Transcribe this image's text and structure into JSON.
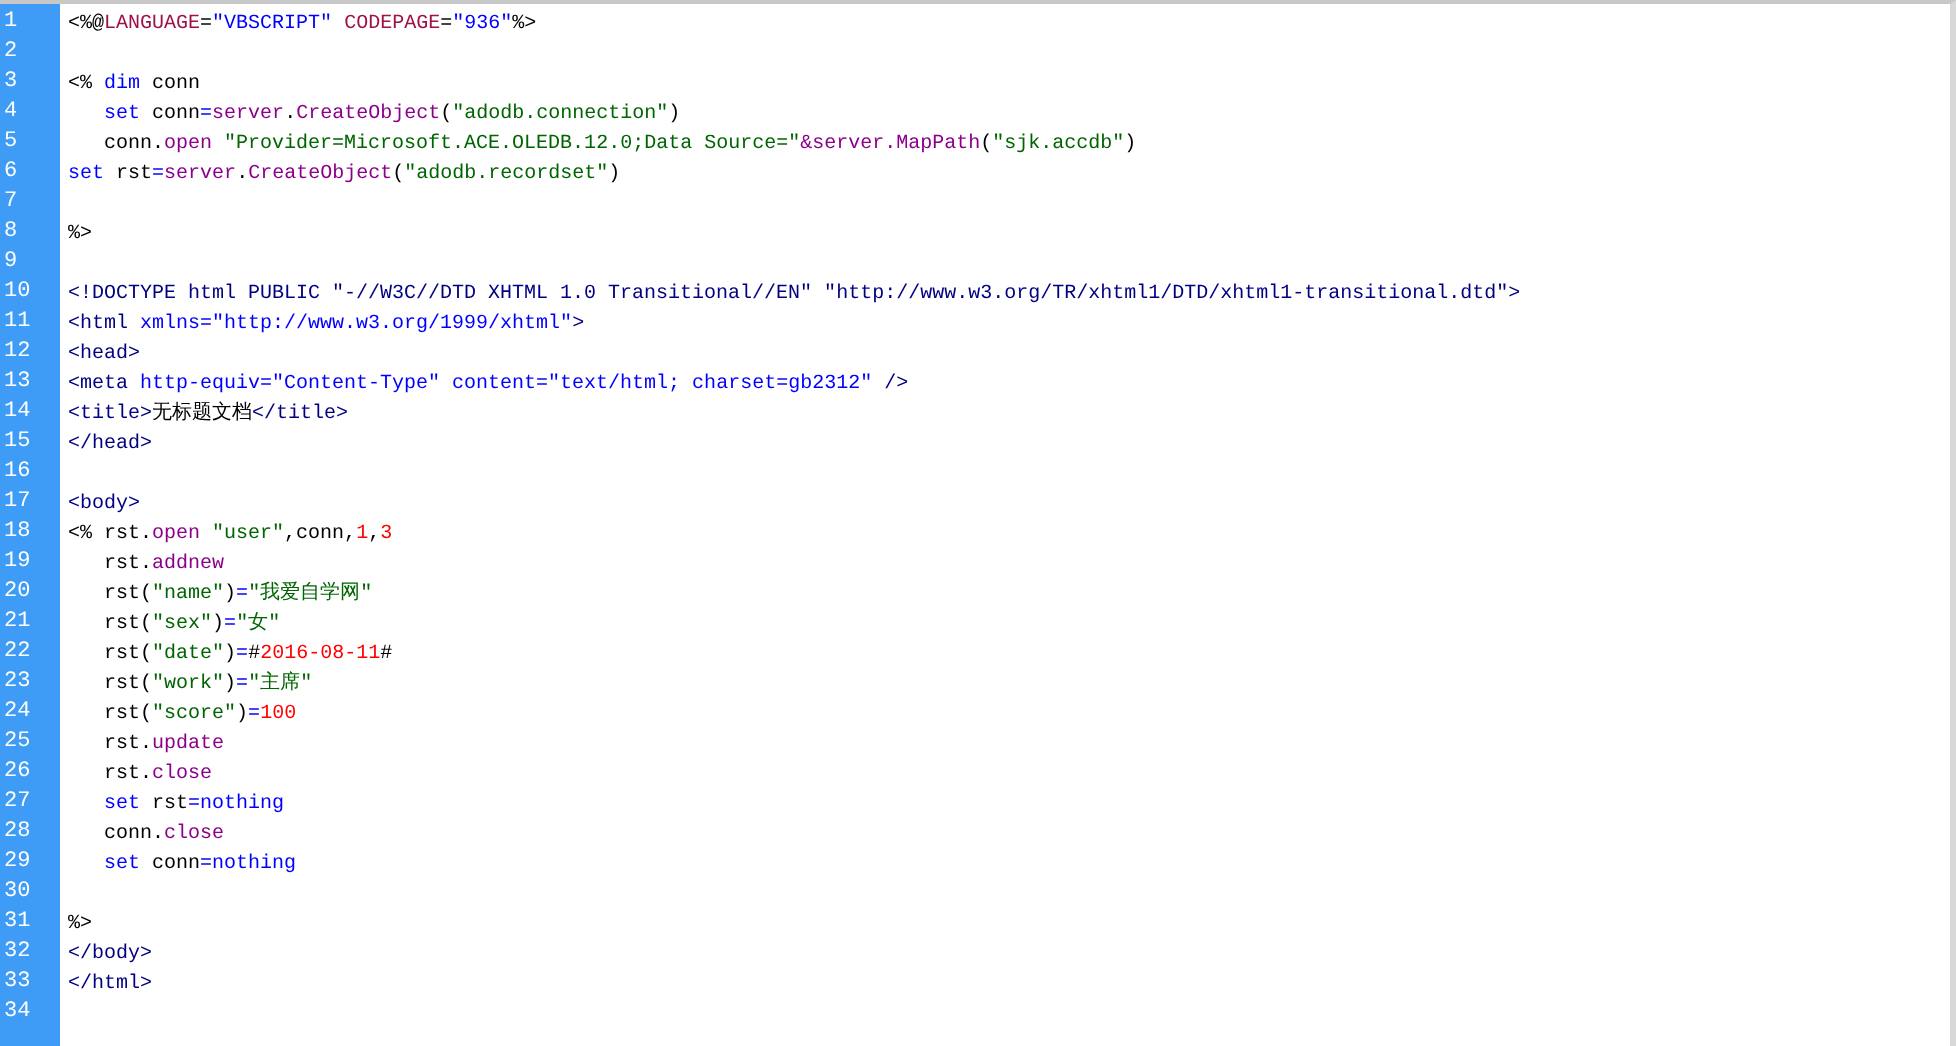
{
  "lines": [
    {
      "number": "1",
      "tokens": [
        {
          "text": "<%@",
          "kind": "plain"
        },
        {
          "text": "LANGUAGE",
          "kind": "attr"
        },
        {
          "text": "=",
          "kind": "plain"
        },
        {
          "text": "\"VBSCRIPT\"",
          "kind": "value"
        },
        {
          "text": " CODEPAGE",
          "kind": "attr"
        },
        {
          "text": "=",
          "kind": "plain"
        },
        {
          "text": "\"936\"",
          "kind": "value"
        },
        {
          "text": "%>",
          "kind": "plain"
        }
      ]
    },
    {
      "number": "2"
    },
    {
      "number": "3",
      "tokens": [
        {
          "text": "<% ",
          "kind": "plain"
        },
        {
          "text": "dim",
          "kind": "keyword"
        },
        {
          "text": " conn",
          "kind": "plain"
        }
      ]
    },
    {
      "number": "4",
      "tokens": [
        {
          "text": "   set",
          "kind": "keyword"
        },
        {
          "text": " conn",
          "kind": "plain"
        },
        {
          "text": "=",
          "kind": "keyword"
        },
        {
          "text": "server",
          "kind": "object"
        },
        {
          "text": ".",
          "kind": "plain"
        },
        {
          "text": "CreateObject",
          "kind": "object"
        },
        {
          "text": "(",
          "kind": "plain"
        },
        {
          "text": "\"adodb.connection\"",
          "kind": "string"
        },
        {
          "text": ")",
          "kind": "plain"
        }
      ]
    },
    {
      "number": "5",
      "tokens": [
        {
          "text": "   conn.",
          "kind": "plain"
        },
        {
          "text": "open",
          "kind": "object"
        },
        {
          "text": " \"Provider=Microsoft.ACE.OLEDB.12.0;Data Source=\"",
          "kind": "string"
        },
        {
          "text": "&server.",
          "kind": "object"
        },
        {
          "text": "MapPath",
          "kind": "object"
        },
        {
          "text": "(",
          "kind": "plain"
        },
        {
          "text": "\"sjk.accdb\"",
          "kind": "string"
        },
        {
          "text": ")",
          "kind": "plain"
        }
      ]
    },
    {
      "number": "6",
      "tokens": [
        {
          "text": "set",
          "kind": "keyword"
        },
        {
          "text": " rst",
          "kind": "plain"
        },
        {
          "text": "=",
          "kind": "keyword"
        },
        {
          "text": "server",
          "kind": "object"
        },
        {
          "text": ".",
          "kind": "plain"
        },
        {
          "text": "CreateObject",
          "kind": "object"
        },
        {
          "text": "(",
          "kind": "plain"
        },
        {
          "text": "\"adodb.recordset\"",
          "kind": "string"
        },
        {
          "text": ")",
          "kind": "plain"
        }
      ]
    },
    {
      "number": "7"
    },
    {
      "number": "8",
      "tokens": [
        {
          "text": "%>",
          "kind": "plain"
        }
      ]
    },
    {
      "number": "9"
    },
    {
      "number": "10",
      "tokens": [
        {
          "text": "<!DOCTYPE html PUBLIC \"-//W3C//DTD XHTML 1.0 Transitional//EN\" \"http://www.w3.org/TR/xhtml1/DTD/xhtml1-transitional.dtd\">",
          "kind": "tag"
        }
      ]
    },
    {
      "number": "11",
      "tokens": [
        {
          "text": "<html ",
          "kind": "tag"
        },
        {
          "text": "xmlns=\"http://www.w3.org/1999/xhtml\"",
          "kind": "value"
        },
        {
          "text": ">",
          "kind": "tag"
        }
      ]
    },
    {
      "number": "12",
      "tokens": [
        {
          "text": "<head>",
          "kind": "tag"
        }
      ]
    },
    {
      "number": "13",
      "tokens": [
        {
          "text": "<meta ",
          "kind": "tag"
        },
        {
          "text": "http-equiv=\"Content-Type\" content=\"text/html; charset=gb2312\" ",
          "kind": "value"
        },
        {
          "text": "/>",
          "kind": "tag"
        }
      ]
    },
    {
      "number": "14",
      "tokens": [
        {
          "text": "<title>",
          "kind": "tag"
        },
        {
          "text": "无标题文档",
          "kind": "plain"
        },
        {
          "text": "</title>",
          "kind": "tag"
        }
      ]
    },
    {
      "number": "15",
      "tokens": [
        {
          "text": "</head>",
          "kind": "tag"
        }
      ]
    },
    {
      "number": "16"
    },
    {
      "number": "17",
      "tokens": [
        {
          "text": "<body>",
          "kind": "tag"
        }
      ]
    },
    {
      "number": "18",
      "tokens": [
        {
          "text": "<% rst.",
          "kind": "plain"
        },
        {
          "text": "open",
          "kind": "object"
        },
        {
          "text": " \"user\"",
          "kind": "string"
        },
        {
          "text": ",conn,",
          "kind": "plain"
        },
        {
          "text": "1",
          "kind": "number"
        },
        {
          "text": ",",
          "kind": "plain"
        },
        {
          "text": "3",
          "kind": "number"
        }
      ]
    },
    {
      "number": "19",
      "tokens": [
        {
          "text": "   rst.",
          "kind": "plain"
        },
        {
          "text": "addnew",
          "kind": "object"
        }
      ]
    },
    {
      "number": "20",
      "tokens": [
        {
          "text": "   rst(",
          "kind": "plain"
        },
        {
          "text": "\"name\"",
          "kind": "string"
        },
        {
          "text": ")",
          "kind": "plain"
        },
        {
          "text": "=",
          "kind": "keyword"
        },
        {
          "text": "\"我爱自学网\"",
          "kind": "string"
        }
      ]
    },
    {
      "number": "21",
      "tokens": [
        {
          "text": "   rst(",
          "kind": "plain"
        },
        {
          "text": "\"sex\"",
          "kind": "string"
        },
        {
          "text": ")",
          "kind": "plain"
        },
        {
          "text": "=",
          "kind": "keyword"
        },
        {
          "text": "\"女\"",
          "kind": "string"
        }
      ]
    },
    {
      "number": "22",
      "tokens": [
        {
          "text": "   rst(",
          "kind": "plain"
        },
        {
          "text": "\"date\"",
          "kind": "string"
        },
        {
          "text": ")",
          "kind": "plain"
        },
        {
          "text": "=",
          "kind": "keyword"
        },
        {
          "text": "#",
          "kind": "plain"
        },
        {
          "text": "2016-08-11",
          "kind": "number"
        },
        {
          "text": "#",
          "kind": "plain"
        }
      ]
    },
    {
      "number": "23",
      "tokens": [
        {
          "text": "   rst(",
          "kind": "plain"
        },
        {
          "text": "\"work\"",
          "kind": "string"
        },
        {
          "text": ")",
          "kind": "plain"
        },
        {
          "text": "=",
          "kind": "keyword"
        },
        {
          "text": "\"主席\"",
          "kind": "string"
        }
      ]
    },
    {
      "number": "24",
      "tokens": [
        {
          "text": "   rst(",
          "kind": "plain"
        },
        {
          "text": "\"score\"",
          "kind": "string"
        },
        {
          "text": ")",
          "kind": "plain"
        },
        {
          "text": "=",
          "kind": "keyword"
        },
        {
          "text": "100",
          "kind": "number"
        }
      ]
    },
    {
      "number": "25",
      "tokens": [
        {
          "text": "   rst.",
          "kind": "plain"
        },
        {
          "text": "update",
          "kind": "object"
        }
      ]
    },
    {
      "number": "26",
      "tokens": [
        {
          "text": "   rst.",
          "kind": "plain"
        },
        {
          "text": "close",
          "kind": "object"
        }
      ]
    },
    {
      "number": "27",
      "tokens": [
        {
          "text": "   set",
          "kind": "keyword"
        },
        {
          "text": " rst",
          "kind": "plain"
        },
        {
          "text": "=nothing",
          "kind": "keyword"
        }
      ]
    },
    {
      "number": "28",
      "tokens": [
        {
          "text": "   conn.",
          "kind": "plain"
        },
        {
          "text": "close",
          "kind": "object"
        }
      ]
    },
    {
      "number": "29",
      "tokens": [
        {
          "text": "   set",
          "kind": "keyword"
        },
        {
          "text": " conn",
          "kind": "plain"
        },
        {
          "text": "=nothing",
          "kind": "keyword"
        }
      ]
    },
    {
      "number": "30"
    },
    {
      "number": "31",
      "tokens": [
        {
          "text": "%>",
          "kind": "plain"
        }
      ]
    },
    {
      "number": "32",
      "tokens": [
        {
          "text": "</body>",
          "kind": "tag"
        }
      ]
    },
    {
      "number": "33",
      "tokens": [
        {
          "text": "</html>",
          "kind": "tag"
        }
      ]
    },
    {
      "number": "34"
    }
  ]
}
